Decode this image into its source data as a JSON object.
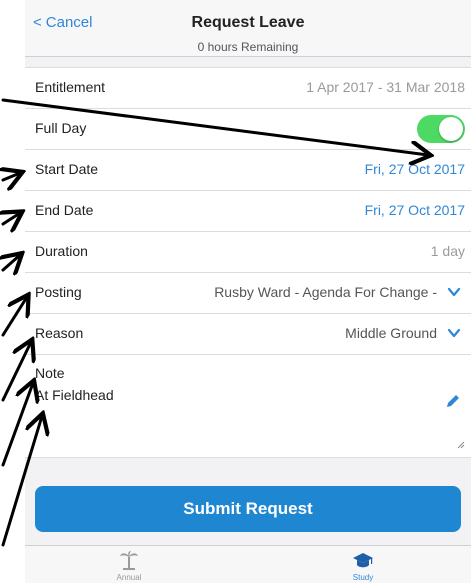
{
  "nav": {
    "cancel_label": "Cancel",
    "title": "Request Leave",
    "subtitle": "0 hours Remaining"
  },
  "form": {
    "entitlement": {
      "label": "Entitlement",
      "value": "1 Apr 2017 - 31 Mar 2018"
    },
    "full_day": {
      "label": "Full Day",
      "on": true
    },
    "start_date": {
      "label": "Start Date",
      "value": "Fri, 27 Oct 2017"
    },
    "end_date": {
      "label": "End Date",
      "value": "Fri, 27 Oct 2017"
    },
    "duration": {
      "label": "Duration",
      "value": "1 day"
    },
    "posting": {
      "label": "Posting",
      "value": "Rusby Ward - Agenda For Change -"
    },
    "reason": {
      "label": "Reason",
      "value": "Middle Ground"
    },
    "note": {
      "label": "Note",
      "value": "At Fieldhead"
    }
  },
  "submit_label": "Submit Request",
  "tabs": [
    {
      "label": "Annual",
      "icon": "palm-tree-icon",
      "active": false
    },
    {
      "label": "Study",
      "icon": "graduation-cap-icon",
      "active": true
    }
  ],
  "colors": {
    "accent": "#2f87d6",
    "toggle_on": "#4cd964",
    "button": "#1f86d2"
  }
}
